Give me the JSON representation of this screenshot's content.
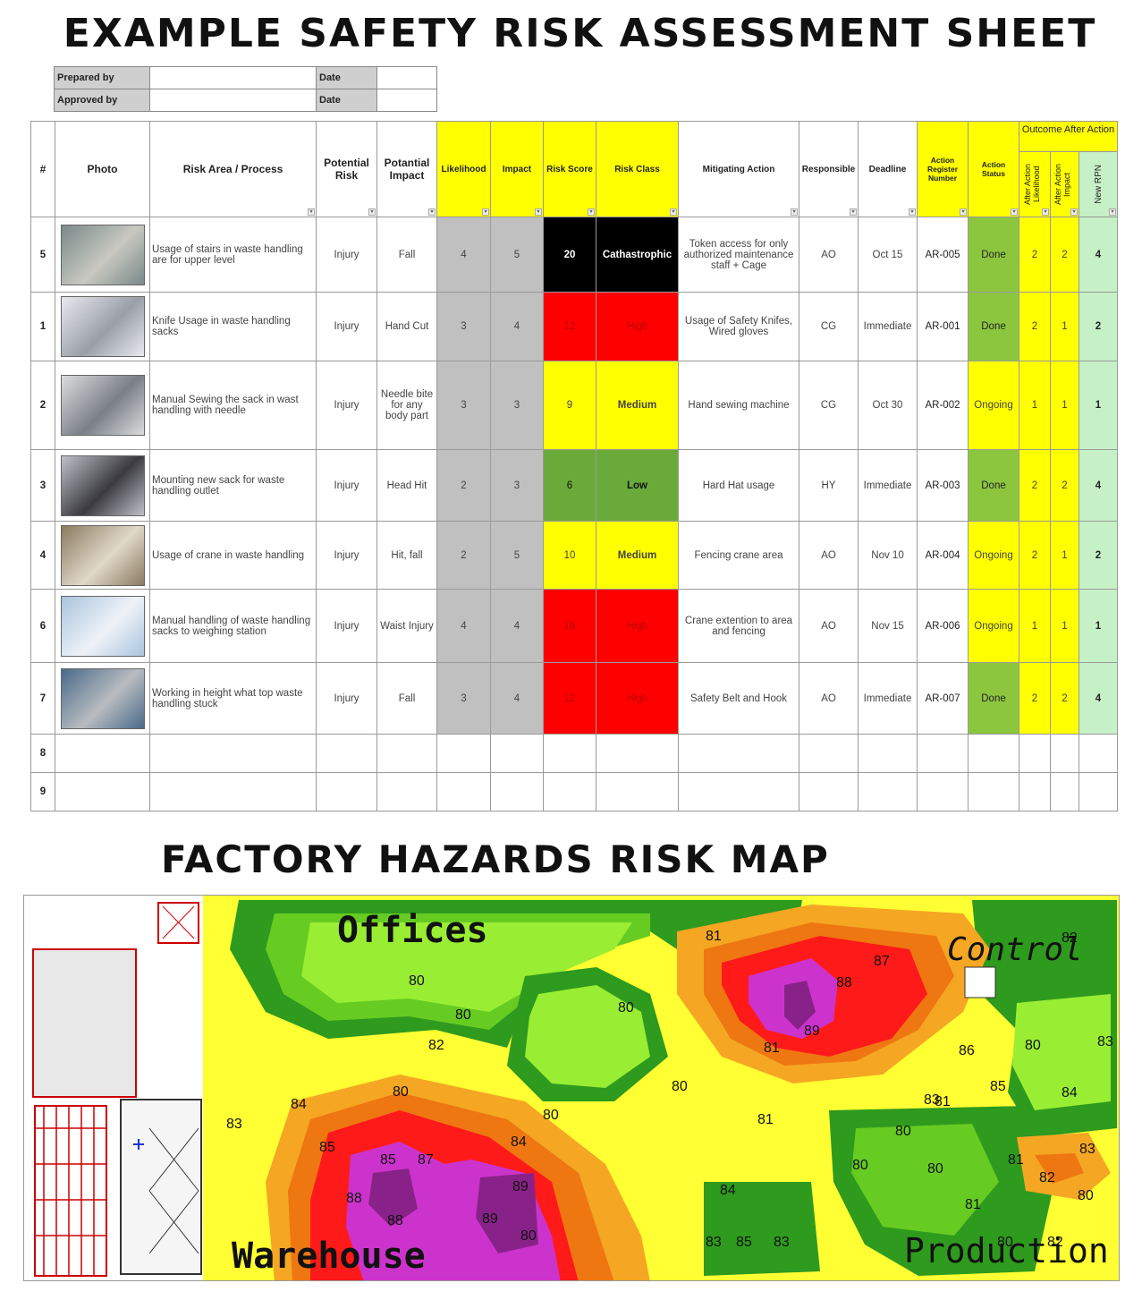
{
  "title": "EXAMPLE SAFETY RISK ASSESSMENT SHEET",
  "info": {
    "prepared_by_label": "Prepared by",
    "approved_by_label": "Approved by",
    "date_label": "Date"
  },
  "headers": {
    "num": "#",
    "photo": "Photo",
    "risk_area": "Risk Area / Process",
    "potential_risk": "Potential Risk",
    "potential_impact": "Potantial Impact",
    "likelihood": "Likelihood",
    "impact": "Impact",
    "risk_score": "Risk Score",
    "risk_class": "Risk Class",
    "mitigating_action": "Mitigating Action",
    "responsible": "Responsible",
    "deadline": "Deadline",
    "action_register": "Action Register Number",
    "action_status": "Action Status",
    "outcome": "Outcome After Action",
    "after_likelihood": "After Action Likelihood",
    "after_impact": "After Action Impact",
    "new_rpn": "New RPN"
  },
  "rows": [
    {
      "num": "5",
      "area": "Usage of stairs in waste handling are for upper level",
      "risk": "Injury",
      "impact_desc": "Fall",
      "likelihood": "4",
      "impact": "5",
      "score": "20",
      "class": "Cathastrophic",
      "action": "Token access for only authorized maintenance staff + Cage",
      "resp": "AO",
      "deadline": "Oct 15",
      "reg": "AR-005",
      "status": "Done",
      "al": "2",
      "ai": "2",
      "rpn": "4"
    },
    {
      "num": "1",
      "area": "Knife Usage in waste handling sacks",
      "risk": "Injury",
      "impact_desc": "Hand Cut",
      "likelihood": "3",
      "impact": "4",
      "score": "12",
      "class": "High",
      "action": "Usage of Safety Knifes, Wired gloves",
      "resp": "CG",
      "deadline": "Immediate",
      "reg": "AR-001",
      "status": "Done",
      "al": "2",
      "ai": "1",
      "rpn": "2"
    },
    {
      "num": "2",
      "area": "Manual Sewing the sack in wast handling with needle",
      "risk": "Injury",
      "impact_desc": "Needle bite for any body part",
      "likelihood": "3",
      "impact": "3",
      "score": "9",
      "class": "Medium",
      "action": "Hand sewing machine",
      "resp": "CG",
      "deadline": "Oct 30",
      "reg": "AR-002",
      "status": "Ongoing",
      "al": "1",
      "ai": "1",
      "rpn": "1"
    },
    {
      "num": "3",
      "area": "Mounting new sack for waste handling outlet",
      "risk": "Injury",
      "impact_desc": "Head Hit",
      "likelihood": "2",
      "impact": "3",
      "score": "6",
      "class": "Low",
      "action": "Hard Hat usage",
      "resp": "HY",
      "deadline": "Immediate",
      "reg": "AR-003",
      "status": "Done",
      "al": "2",
      "ai": "2",
      "rpn": "4"
    },
    {
      "num": "4",
      "area": "Usage of crane in waste handling",
      "risk": "Injury",
      "impact_desc": "Hit, fall",
      "likelihood": "2",
      "impact": "5",
      "score": "10",
      "class": "Medium",
      "action": "Fencing crane area",
      "resp": "AO",
      "deadline": "Nov 10",
      "reg": "AR-004",
      "status": "Ongoing",
      "al": "2",
      "ai": "1",
      "rpn": "2"
    },
    {
      "num": "6",
      "area": "Manual handling of waste handling sacks to weighing station",
      "risk": "Injury",
      "impact_desc": "Waist Injury",
      "likelihood": "4",
      "impact": "4",
      "score": "16",
      "class": "High",
      "action": "Crane extention to area and fencing",
      "resp": "AO",
      "deadline": "Nov 15",
      "reg": "AR-006",
      "status": "Ongoing",
      "al": "1",
      "ai": "1",
      "rpn": "1"
    },
    {
      "num": "7",
      "area": "Working in height what top waste handling stuck",
      "risk": "Injury",
      "impact_desc": "Fall",
      "likelihood": "3",
      "impact": "4",
      "score": "12",
      "class": "High",
      "action": "Safety Belt and Hook",
      "resp": "AO",
      "deadline": "Immediate",
      "reg": "AR-007",
      "status": "Done",
      "al": "2",
      "ai": "2",
      "rpn": "4"
    }
  ],
  "empty_rows": [
    "8",
    "9"
  ],
  "map": {
    "title": "FACTORY HAZARDS RISK MAP",
    "labels": {
      "offices": "Offices",
      "control": "Control",
      "warehouse": "Warehouse",
      "production": "Production"
    },
    "contour_values": [
      "80",
      "80",
      "80",
      "81",
      "82",
      "83",
      "84",
      "85",
      "86",
      "87",
      "88",
      "89",
      "80",
      "80",
      "81",
      "83",
      "84",
      "85",
      "80",
      "82",
      "81",
      "80",
      "84",
      "83",
      "85",
      "87",
      "88",
      "88",
      "89",
      "89",
      "84",
      "83",
      "82",
      "80",
      "81",
      "80",
      "80",
      "80",
      "81",
      "80",
      "83",
      "85",
      "83",
      "80",
      "81",
      "82"
    ]
  }
}
